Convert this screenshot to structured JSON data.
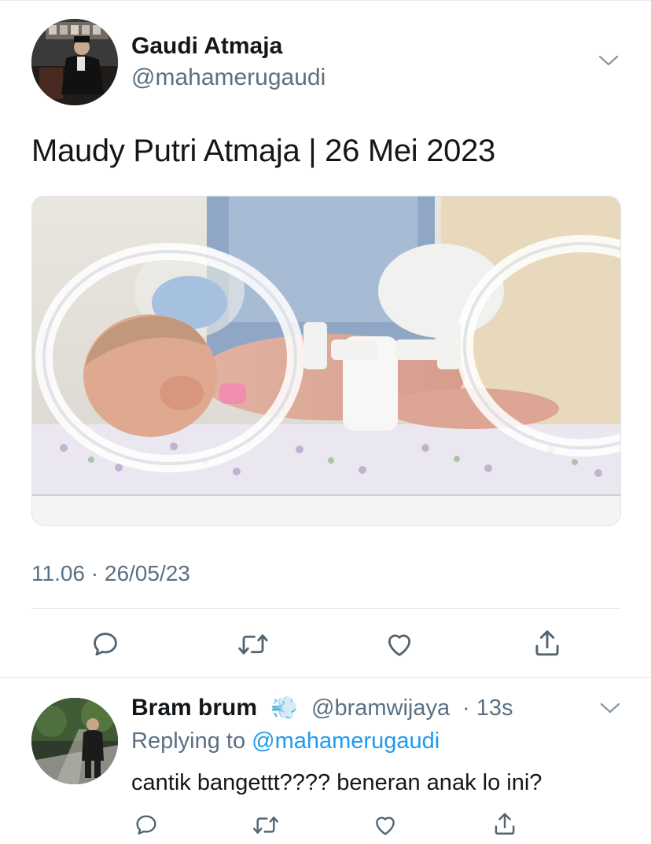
{
  "tweet": {
    "author_name": "Gaudi Atmaja",
    "author_handle": "@mahamerugaudi",
    "text": "Maudy Putri Atmaja | 26 Mei 2023",
    "media_icon": "photo-newborn-in-incubator",
    "timestamp": "11.06 · 26/05/23",
    "actions": [
      "reply-icon",
      "retweet-icon",
      "like-icon",
      "share-icon"
    ]
  },
  "reply": {
    "author_name": "Bram brum",
    "name_emoji": "💨",
    "author_handle": "@bramwijaya",
    "time": "· 13s",
    "replying_prefix": "Replying to ",
    "replying_to": "@mahamerugaudi",
    "text": "cantik bangettt???? beneran anak lo ini?",
    "actions": [
      "reply-icon",
      "retweet-icon",
      "like-icon",
      "share-icon"
    ]
  },
  "colors": {
    "link": "#1d9bf0",
    "muted": "#5b7083",
    "icon": "#536471",
    "text": "#14171a"
  }
}
